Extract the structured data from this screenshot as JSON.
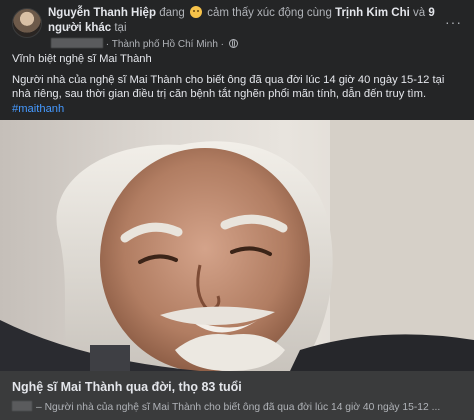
{
  "header": {
    "author": "Nguyễn Thanh Hiệp",
    "status_prefix": "đang",
    "feeling": "cảm thấy xúc động cùng",
    "with_name": "Trịnh Kim Chi",
    "and": "và",
    "others": "9 người khác",
    "at": "tại",
    "location": "· Thành phố Hồ Chí Minh ·",
    "more_label": "···"
  },
  "post": {
    "line1": "Vĩnh biệt nghệ sĩ Mai Thành",
    "line2": "Người nhà của nghệ sĩ Mai Thành cho biết ông đã qua đời lúc 14 giờ 40 ngày 15-12 tại nhà riêng, sau thời gian điều trị căn bệnh tắt nghẽn phổi mãn tính, dẫn đến truy tìm.",
    "hashtag": "#maithanh"
  },
  "link": {
    "title": "Nghệ sĩ Mai Thành qua đời, thọ 83 tuổi",
    "description": "– Người nhà của nghệ sĩ Mai Thành cho biết ông đã qua đời lúc 14 giờ 40 ngày 15-12 ..."
  },
  "colors": {
    "card_bg": "#242526",
    "link_bg": "#3a3b3c",
    "hashtag": "#4599ff"
  },
  "icons": [
    "avatar",
    "sad-emoji-icon",
    "globe-icon",
    "more-options-icon"
  ]
}
